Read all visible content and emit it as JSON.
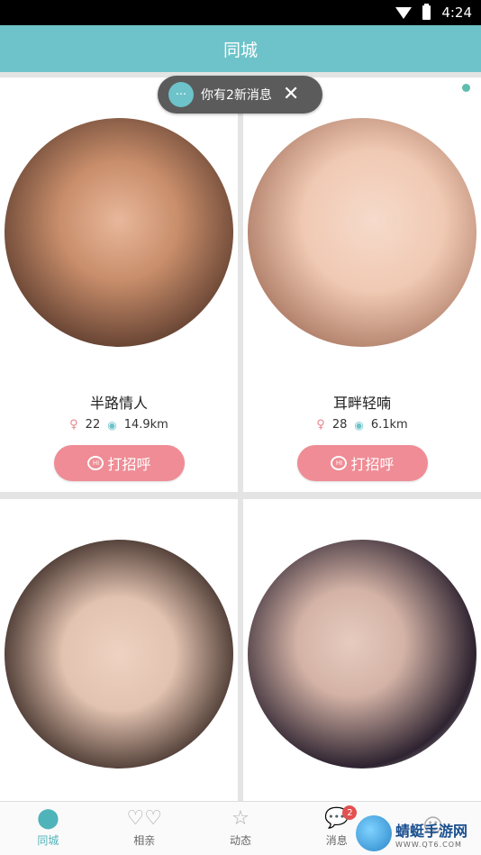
{
  "status_bar": {
    "time": "4:24"
  },
  "header": {
    "title": "同城"
  },
  "toast": {
    "text": "你有2新消息"
  },
  "cards": [
    {
      "name": "半路情人",
      "age": "22",
      "distance": "14.9km",
      "greet_label": "打招呼",
      "avatar_colors": [
        "#c98e6b",
        "#5a3a2c"
      ]
    },
    {
      "name": "耳畔轻喃",
      "age": "28",
      "distance": "6.1km",
      "greet_label": "打招呼",
      "avatar_colors": [
        "#f0c9b3",
        "#9e6a55"
      ]
    },
    {
      "name": "",
      "age": "",
      "distance": "",
      "greet_label": "",
      "avatar_colors": [
        "#e2c2b0",
        "#3a2a24"
      ]
    },
    {
      "name": "",
      "age": "",
      "distance": "",
      "greet_label": "",
      "avatar_colors": [
        "#d4b3a6",
        "#2e2330"
      ]
    }
  ],
  "tabs": [
    {
      "label": "同城",
      "icon": "location-pin-icon",
      "active": true
    },
    {
      "label": "相亲",
      "icon": "hearts-icon",
      "active": false
    },
    {
      "label": "动态",
      "icon": "star-icon",
      "active": false
    },
    {
      "label": "消息",
      "icon": "chat-icon",
      "active": false,
      "badge": "2"
    },
    {
      "label": "",
      "icon": "user-icon",
      "active": false
    }
  ],
  "watermark": {
    "title": "蜻蜓手游网",
    "url": "WWW.QT6.COM"
  },
  "colors": {
    "accent": "#6dc3c9",
    "greet": "#ef8c95",
    "badge": "#e35050"
  }
}
